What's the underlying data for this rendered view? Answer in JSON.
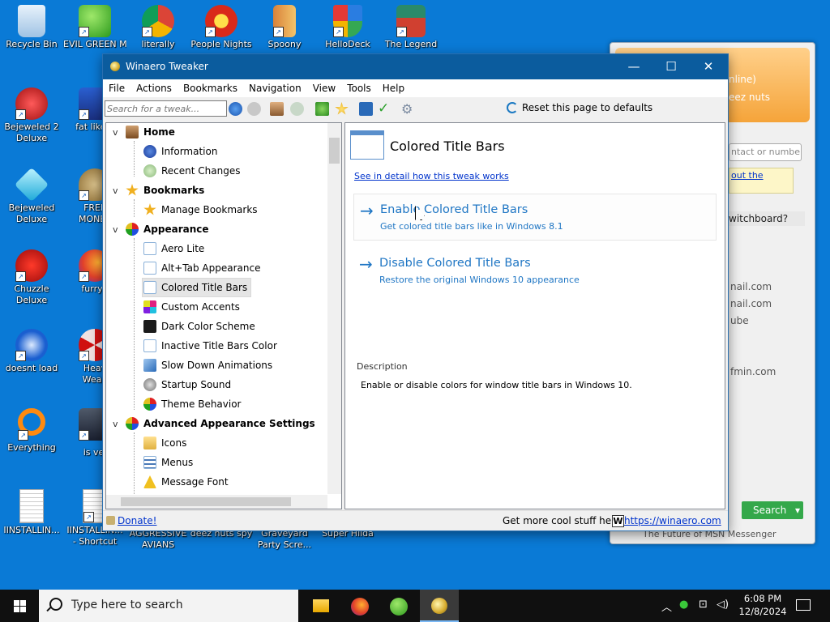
{
  "desktop": {
    "icons": [
      {
        "label": "Recycle Bin"
      },
      {
        "label": "EVIL GREEN MEN C"
      },
      {
        "label": "literally"
      },
      {
        "label": "People Nights"
      },
      {
        "label": "Spoony"
      },
      {
        "label": "HelloDeck"
      },
      {
        "label": "The Legend"
      },
      {
        "label": "Bejeweled 2 Deluxe"
      },
      {
        "label": "fat like d"
      },
      {
        "label": "Bejeweled Deluxe"
      },
      {
        "label": "FREE MONEY"
      },
      {
        "label": "Chuzzle Deluxe"
      },
      {
        "label": "furryp"
      },
      {
        "label": "doesnt load"
      },
      {
        "label": "Heav Weap"
      },
      {
        "label": "Everything"
      },
      {
        "label": "is vei"
      },
      {
        "label": "IINSTALLIN..."
      },
      {
        "label": "IINSTALLIN... - Shortcut"
      },
      {
        "label": "AGGRESSIVE AVIANS"
      },
      {
        "label": "deez nuts spy"
      },
      {
        "label": "Graveyard Party Scre..."
      },
      {
        "label": "Super Hilda"
      }
    ]
  },
  "msn": {
    "status": "nline)",
    "nick": "eez nuts",
    "search_placeholder": "ntact or numbe",
    "banner_link": "out the",
    "switchboard": "witchboard?",
    "rows": [
      "nail.com",
      "nail.com",
      "ube",
      "fmin.com"
    ],
    "search_button": "Search",
    "footer": "The Future of MSN Messenger"
  },
  "window": {
    "title": "Winaero Tweaker",
    "controls": {
      "minimize": "—",
      "maximize": "☐",
      "close": "✕"
    }
  },
  "menubar": {
    "items": [
      "File",
      "Actions",
      "Bookmarks",
      "Navigation",
      "View",
      "Tools",
      "Help"
    ]
  },
  "toolbar": {
    "search_placeholder": "Search for a tweak...",
    "reset_label": "Reset this page to defaults"
  },
  "tree": {
    "nodes": [
      {
        "label": "Home",
        "cat": true
      },
      {
        "label": "Information"
      },
      {
        "label": "Recent Changes"
      },
      {
        "label": "Bookmarks",
        "cat": true
      },
      {
        "label": "Manage Bookmarks"
      },
      {
        "label": "Appearance",
        "cat": true
      },
      {
        "label": "Aero Lite"
      },
      {
        "label": "Alt+Tab Appearance"
      },
      {
        "label": "Colored Title Bars",
        "selected": true
      },
      {
        "label": "Custom Accents"
      },
      {
        "label": "Dark Color Scheme"
      },
      {
        "label": "Inactive Title Bars Color"
      },
      {
        "label": "Slow Down Animations"
      },
      {
        "label": "Startup Sound"
      },
      {
        "label": "Theme Behavior"
      },
      {
        "label": "Advanced Appearance Settings",
        "cat": true
      },
      {
        "label": "Icons"
      },
      {
        "label": "Menus"
      },
      {
        "label": "Message Font"
      }
    ]
  },
  "content": {
    "title": "Colored Title Bars",
    "detail_link": "See in detail how this tweak works",
    "actions": [
      {
        "title": "Enable Colored Title Bars",
        "subtitle": "Get colored title bars like in Windows 8.1"
      },
      {
        "title": "Disable Colored Title Bars",
        "subtitle": "Restore the original Windows 10 appearance"
      }
    ],
    "description_label": "Description",
    "description": "Enable or disable colors for window title bars in Windows 10."
  },
  "status": {
    "donate": "Donate!",
    "more": "Get more cool stuff here:",
    "logo": "W",
    "link": "https://winaero.com"
  },
  "taskbar": {
    "search_placeholder": "Type here to search",
    "time": "6:08 PM",
    "date": "12/8/2024"
  }
}
